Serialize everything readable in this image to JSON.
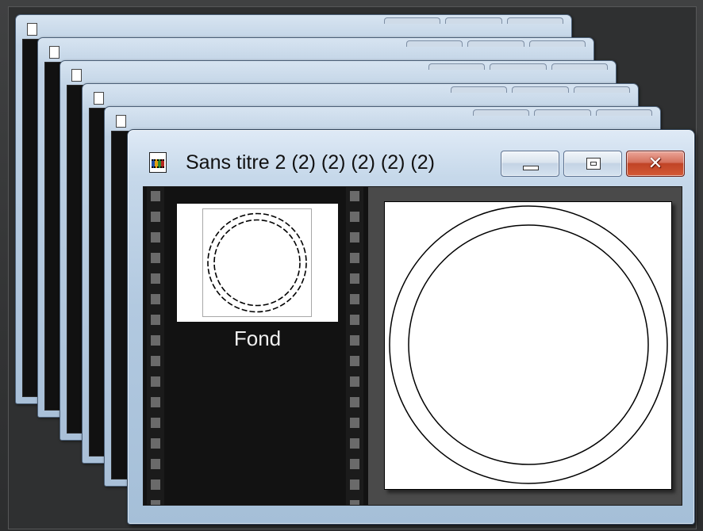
{
  "window": {
    "title": "Sans titre 2 (2) (2) (2) (2) (2)",
    "icon": "film-document-icon",
    "controls": {
      "minimize": "minimize-icon",
      "maximize": "maximize-icon",
      "close": "✕"
    }
  },
  "thumbnail": {
    "label": "Fond"
  },
  "stacked_windows": {
    "count": 5
  },
  "colors": {
    "title_bar": "#c6d8ea",
    "close_button": "#c04326",
    "film_strip": "#121212",
    "canvas_background": "#ffffff"
  }
}
